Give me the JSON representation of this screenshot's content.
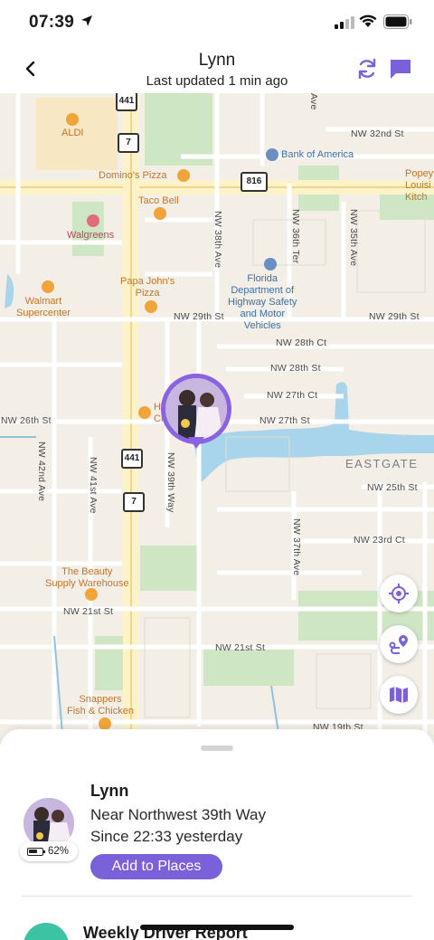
{
  "status_bar": {
    "time": "07:39",
    "battery_icon": "battery-full-icon",
    "wifi_icon": "wifi-icon",
    "signal_icon": "cellular-signal-icon"
  },
  "header": {
    "title": "Lynn",
    "subtitle": "Last updated 1 min ago",
    "accent_color": "#7b61d9"
  },
  "map": {
    "pois": {
      "aldi": "ALDI",
      "dominos": "Domino's Pizza",
      "taco_bell": "Taco Bell",
      "walgreens": "Walgreens",
      "papa_johns": "Papa John's\nPizza",
      "walmart": "Walmart\nSupercenter",
      "bank_of_america": "Bank of America",
      "popeyes": "Popey\nLouisi\nKitch",
      "fl_dept": "Florida\nDepartment of\nHighway Safety\nand Motor\nVehicles",
      "beauty_supply": "The Beauty\nSupply Warehouse",
      "snappers": "Snappers\nFish & Chicken",
      "h_ch": "H\nCh"
    },
    "streets": {
      "nw_32nd": "NW 32nd St",
      "nw_29th_a": "NW 29th St",
      "nw_29th_b": "NW 29th St",
      "nw_28th_ct": "NW 28th Ct",
      "nw_28th_st": "NW 28th St",
      "nw_27th_ct": "NW 27th Ct",
      "nw_27th_st": "NW 27th St",
      "nw_26th_st": "NW 26th St",
      "nw_25th_st": "NW 25th St",
      "nw_23rd_ct": "NW 23rd Ct",
      "nw_21st_a": "NW 21st St",
      "nw_21st_b": "NW 21st St",
      "nw_19th": "NW 19th St",
      "nw_38th_ave": "NW 38th Ave",
      "nw_36th_ter": "NW 36th Ter",
      "nw_35th_ave": "NW 35th Ave",
      "nw_42nd_ave": "NW 42nd Ave",
      "nw_41st_ave": "NW 41st Ave",
      "nw_39th_way": "NW 39th Way",
      "nw_37th_ave": "NW 37th Ave",
      "ave_top": "Ave"
    },
    "shields": {
      "us441_a": "441",
      "fl7_a": "7",
      "fl816": "816",
      "us441_b": "441",
      "fl7_b": "7"
    },
    "area": "EASTGATE"
  },
  "buttons": {
    "locate_icon": "crosshair-icon",
    "directions_icon": "route-pin-icon",
    "map_type_icon": "map-icon"
  },
  "member": {
    "name": "Lynn",
    "location": "Near Northwest 39th Way",
    "since": "Since 22:33 yesterday",
    "battery": "62%",
    "battery_level": 0.62,
    "add_places_label": "Add to Places"
  },
  "report": {
    "title": "Weekly Driver Report"
  }
}
